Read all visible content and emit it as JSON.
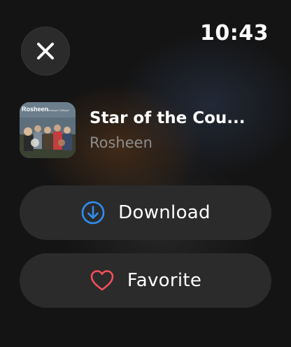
{
  "status_bar": {
    "time": "10:43"
  },
  "close_button": {
    "icon": "close-icon"
  },
  "track": {
    "title": "Star of the Cou...",
    "artist": "Rosheen",
    "artwork": {
      "band_name": "Rosheen",
      "subtitle": "Musique Celtique"
    }
  },
  "actions": {
    "download": {
      "label": "Download",
      "icon": "download-circle-icon",
      "icon_color": "#2f8ff0"
    },
    "favorite": {
      "label": "Favorite",
      "icon": "heart-outline-icon",
      "icon_color": "#f2505a"
    }
  }
}
